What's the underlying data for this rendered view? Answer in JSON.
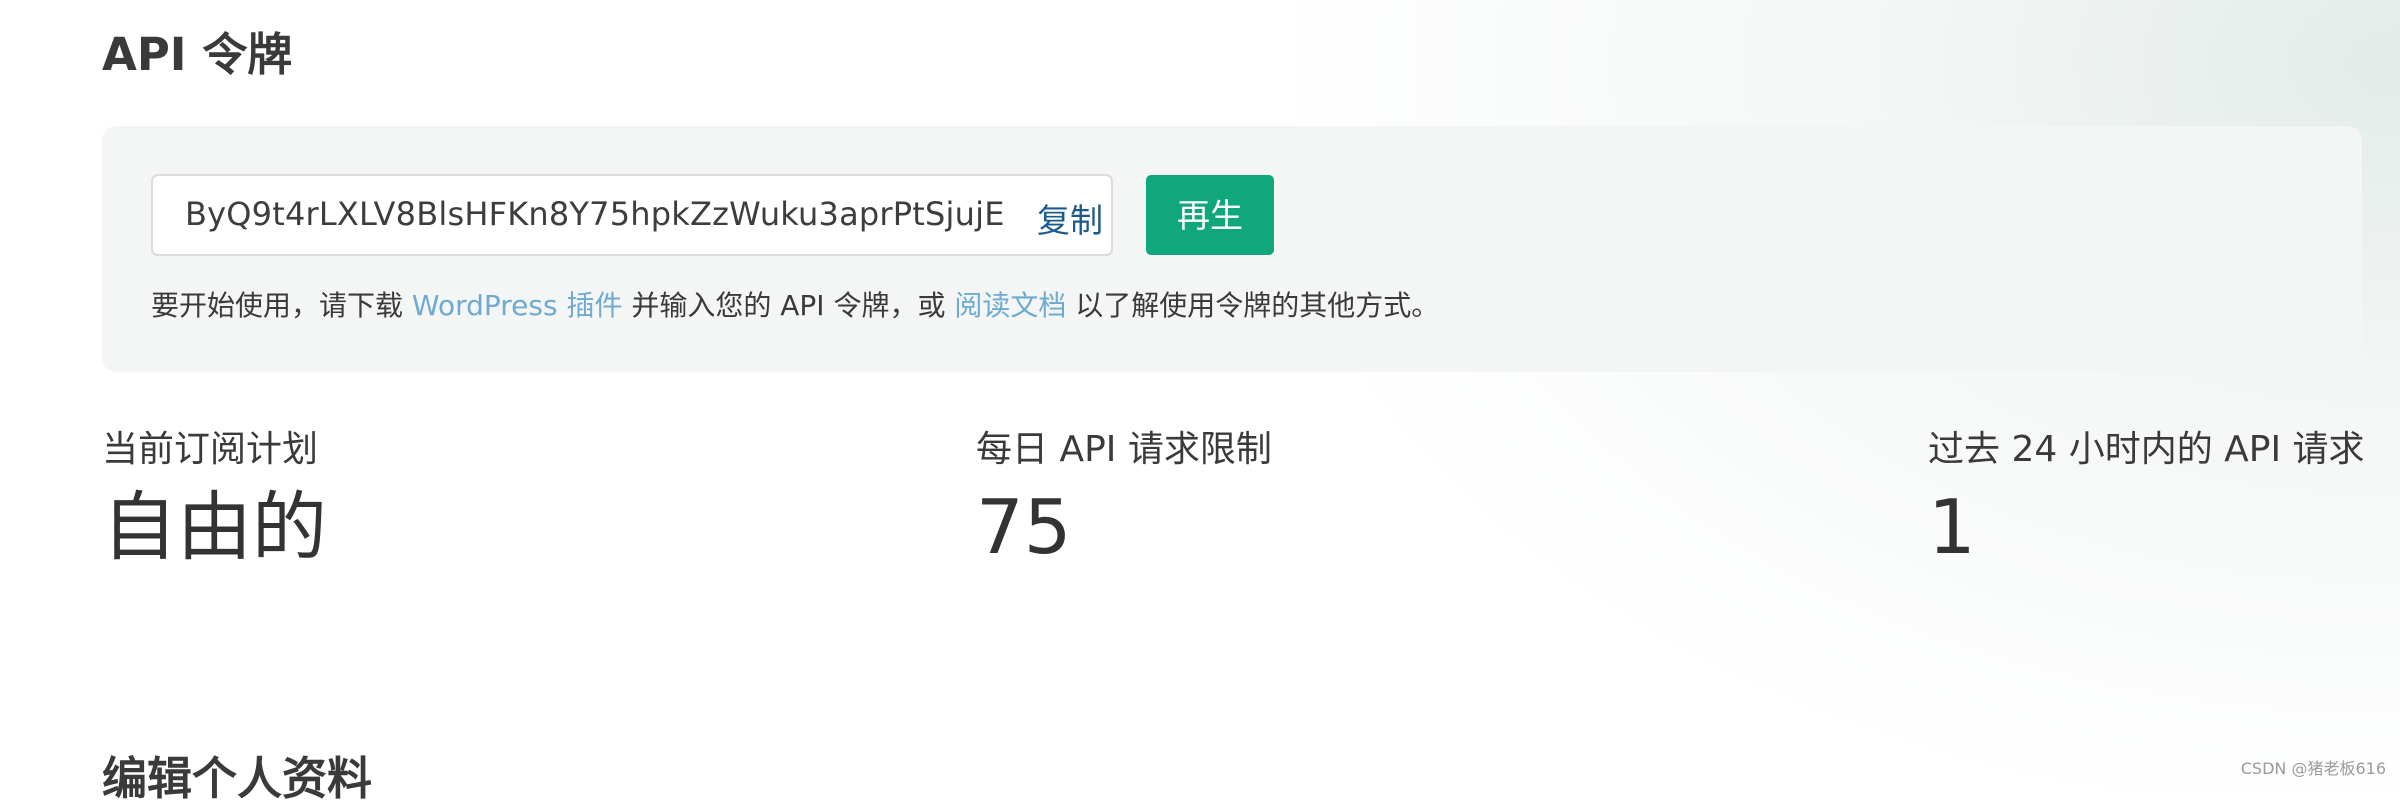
{
  "api_section": {
    "title": "API 令牌",
    "token_value": "ByQ9t4rLXLV8BlsHFKn8Y75hpkZzWuku3aprPtSjujE",
    "copy_label": "复制",
    "regenerate_label": "再生",
    "help": {
      "part1": "要开始使用，请下载 ",
      "plugin_link": "WordPress 插件",
      "part2": " 并输入您的 API 令牌，或 ",
      "docs_link": "阅读文档",
      "part3": " 以了解使用令牌的其他方式。"
    }
  },
  "stats": {
    "plan_label": "当前订阅计划",
    "plan_value": "自由的",
    "limit_label": "每日 API 请求限制",
    "limit_value": "75",
    "used_label": "过去 24 小时内的 API 请求",
    "used_value": "1"
  },
  "profile_section": {
    "title": "编辑个人资料"
  },
  "watermark": "CSDN @猪老板616",
  "colors": {
    "accent_green": "#10a77c",
    "link_blue": "#6eaad2",
    "copy_blue": "#1d5a8c"
  }
}
